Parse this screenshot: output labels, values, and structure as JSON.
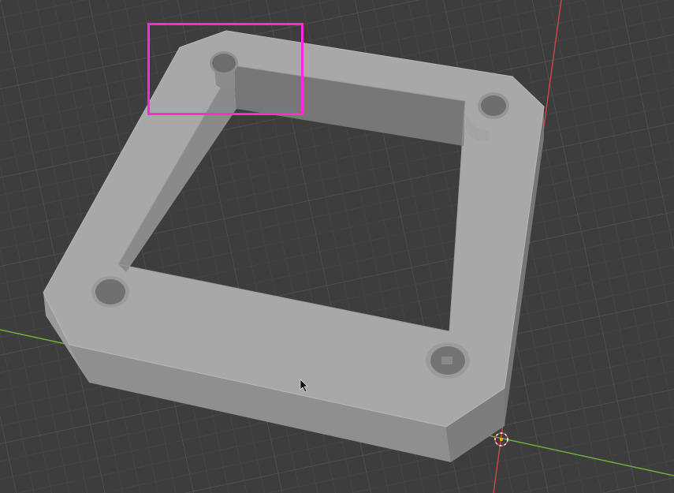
{
  "viewport": {
    "type": "3D Viewport",
    "background_color": "#3d3d3d",
    "grid_color": "#555555",
    "x_axis_color": "#d24a4a",
    "y_axis_color": "#7fbf3f",
    "selection_highlight_color": "#ff2bd6"
  },
  "object": {
    "shape": "square frame with chamfered corners",
    "mounting_holes": 4,
    "surface_color": "#a9a9a9"
  },
  "icons": {
    "cursor": "mouse-pointer-icon",
    "origin": "3d-cursor-icon"
  }
}
